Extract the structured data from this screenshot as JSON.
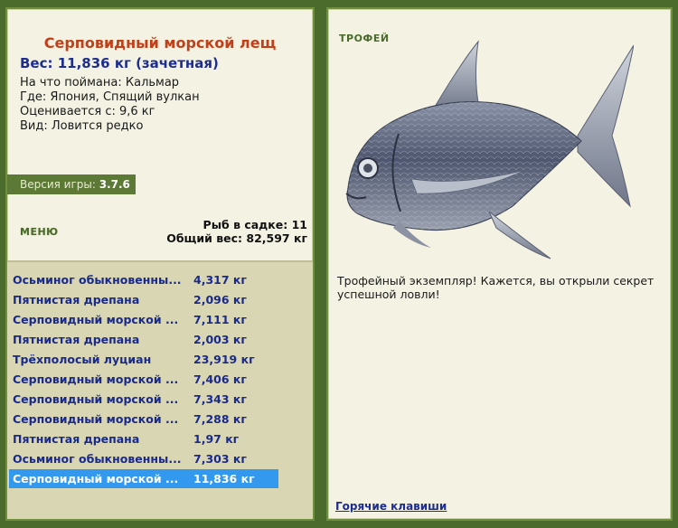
{
  "fish": {
    "name": "Серповидный морской лещ",
    "weight": "Вес: 11,836 кг (зачетная)",
    "bait": "На что поймана: Кальмар",
    "location": "Где: Япония, Спящий вулкан",
    "valued_from": "Оценивается с: 9,6 кг",
    "rarity": "Вид: Ловится редко"
  },
  "version": {
    "label": "Версия игры:",
    "value": "3.7.6"
  },
  "menu_label": "МЕНЮ",
  "stats": {
    "fish_count": "Рыб в садке: 11",
    "total_weight": "Общий вес: 82,597 кг"
  },
  "catch_list": [
    {
      "name": "Осьминог обыкновенны...",
      "weight": "4,317 кг"
    },
    {
      "name": "Пятнистая дрепана",
      "weight": "2,096 кг"
    },
    {
      "name": "Серповидный морской ...",
      "weight": "7,111 кг"
    },
    {
      "name": "Пятнистая дрепана",
      "weight": "2,003 кг"
    },
    {
      "name": "Трёхполосый луциан",
      "weight": "23,919 кг"
    },
    {
      "name": "Серповидный морской ...",
      "weight": "7,406 кг"
    },
    {
      "name": "Серповидный морской ...",
      "weight": "7,343 кг"
    },
    {
      "name": "Серповидный морской ...",
      "weight": "7,288 кг"
    },
    {
      "name": "Пятнистая дрепана",
      "weight": "1,97 кг"
    },
    {
      "name": "Осьминог обыкновенны...",
      "weight": "7,303 кг"
    },
    {
      "name": "Серповидный морской ...",
      "weight": "11,836 кг"
    }
  ],
  "selected_index": 10,
  "trophy_label": "ТРОФЕЙ",
  "description": "Трофейный экземпляр! Кажется, вы открыли секрет успешной ловли!",
  "hotkeys_label": "Горячие клавиши",
  "colors": {
    "background": "#4a6b2c",
    "panel": "#f4f2e2",
    "title": "#c0401a",
    "link": "#1d2d8f",
    "selected": "#3399ee"
  }
}
